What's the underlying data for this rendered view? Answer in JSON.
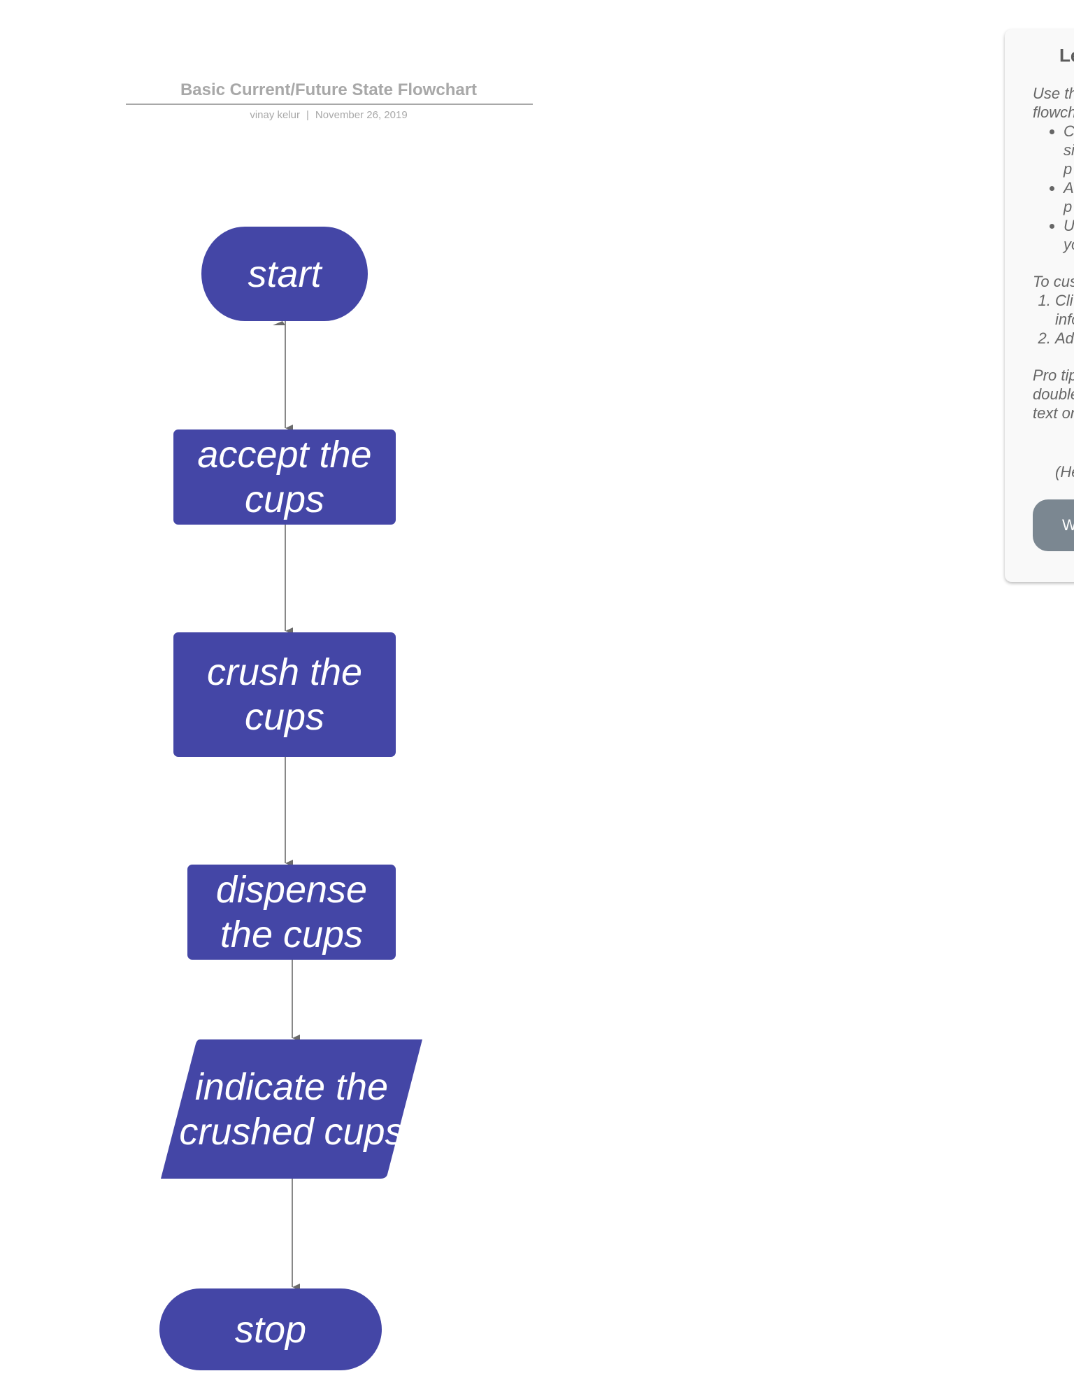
{
  "document": {
    "title": "Basic Current/Future State Flowchart",
    "author": "vinay kelur",
    "separator": "|",
    "date": "November 26, 2019"
  },
  "colors": {
    "node_fill": "#4446a6",
    "node_text": "#ffffff",
    "connector": "#6b6b6b",
    "muted_text": "#a8a8a8"
  },
  "flowchart": {
    "nodes": [
      {
        "id": "start",
        "shape": "terminator",
        "text": "start"
      },
      {
        "id": "accept",
        "shape": "process",
        "text": "accept the\ncups"
      },
      {
        "id": "crush",
        "shape": "process",
        "text": "crush the\ncups"
      },
      {
        "id": "dispense",
        "shape": "process",
        "text": "dispense\nthe cups"
      },
      {
        "id": "indicate",
        "shape": "data",
        "text": "indicate the\ncrushed cups"
      },
      {
        "id": "stop",
        "shape": "terminator",
        "text": "stop"
      }
    ],
    "edges": [
      {
        "from": "start",
        "to": "accept"
      },
      {
        "from": "accept",
        "to": "crush"
      },
      {
        "from": "crush",
        "to": "dispense"
      },
      {
        "from": "dispense",
        "to": "indicate"
      },
      {
        "from": "indicate",
        "to": "stop"
      }
    ]
  },
  "side_panel": {
    "heading": "Le",
    "intro": "Use th\nflowch",
    "bullets": [
      "C\nsi\np",
      "A\np",
      "U\nyo"
    ],
    "customize_intro": "To cus",
    "steps": [
      "Cli\ninfo",
      "Ad"
    ],
    "pro_tip": "Pro tip\ndouble\ntext or",
    "help": "(He",
    "button_label": "W"
  }
}
